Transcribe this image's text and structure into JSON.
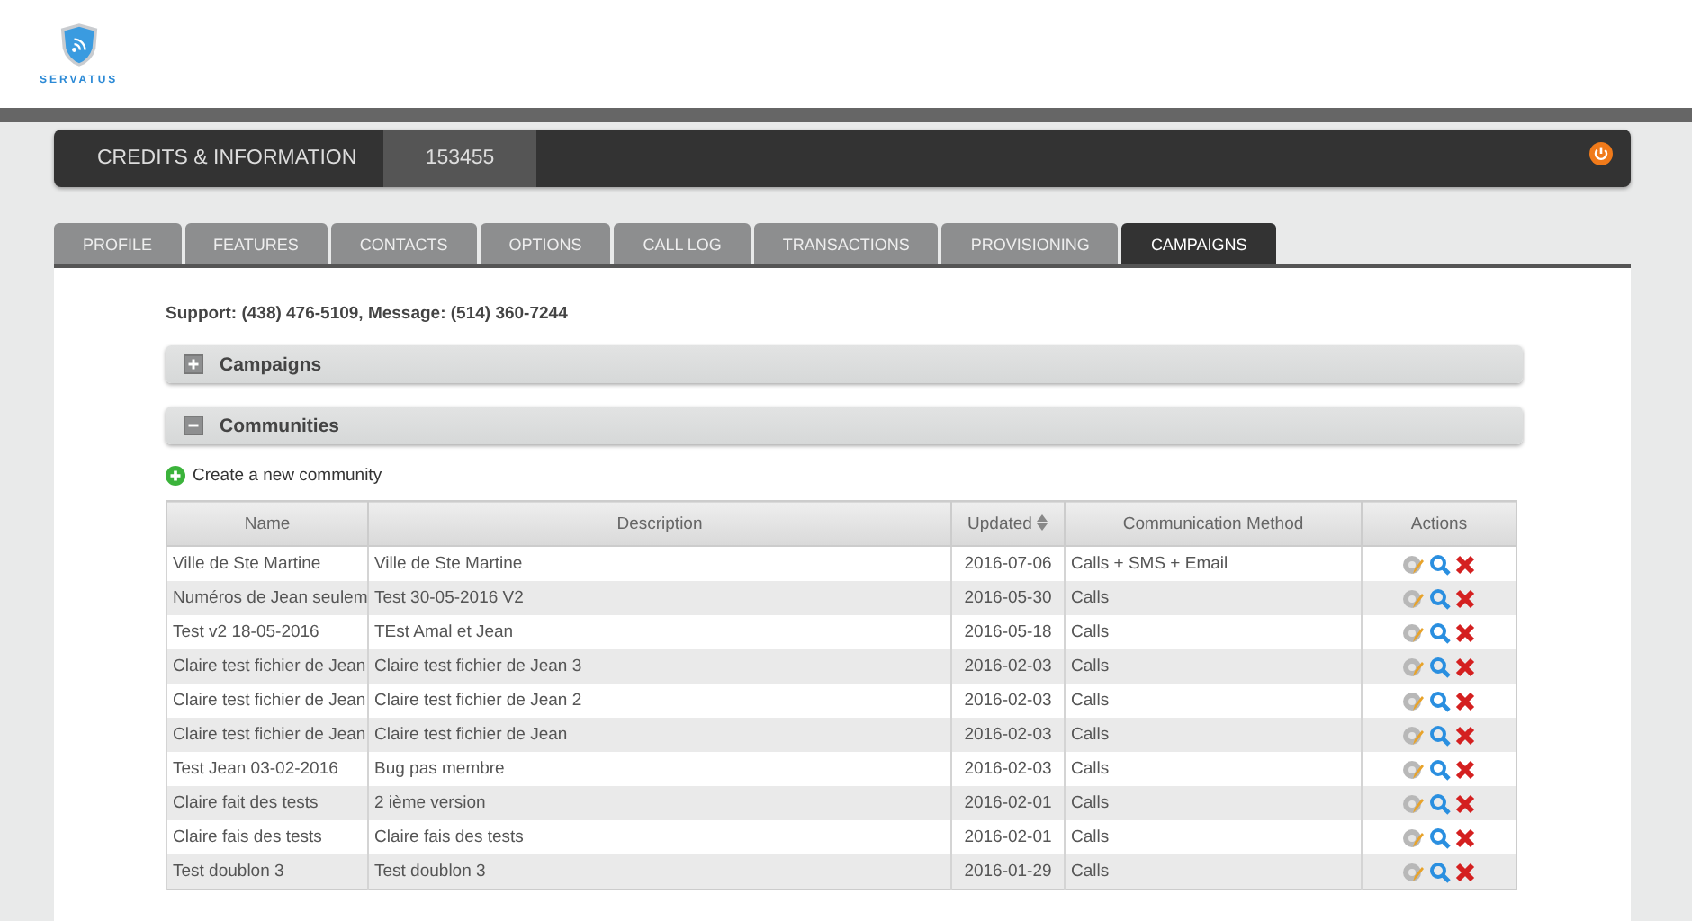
{
  "logo": {
    "text": "SERVATUS"
  },
  "top_bar": {
    "title": "CREDITS & INFORMATION",
    "account": "153455"
  },
  "tabs": [
    {
      "label": "PROFILE",
      "selected": false
    },
    {
      "label": "FEATURES",
      "selected": false
    },
    {
      "label": "CONTACTS",
      "selected": false
    },
    {
      "label": "OPTIONS",
      "selected": false
    },
    {
      "label": "CALL LOG",
      "selected": false
    },
    {
      "label": "TRANSACTIONS",
      "selected": false
    },
    {
      "label": "PROVISIONING",
      "selected": false
    },
    {
      "label": "CAMPAIGNS",
      "selected": true
    }
  ],
  "support_line": "Support: (438) 476-5109, Message: (514) 360-7244",
  "sections": [
    {
      "title": "Campaigns",
      "expanded": false
    },
    {
      "title": "Communities",
      "expanded": true
    }
  ],
  "create_link": "Create a new community",
  "table": {
    "columns": [
      {
        "label": "Name",
        "sortable": false
      },
      {
        "label": "Description",
        "sortable": false
      },
      {
        "label": "Updated",
        "sortable": true
      },
      {
        "label": "Communication Method",
        "sortable": false
      },
      {
        "label": "Actions",
        "sortable": false
      }
    ],
    "rows": [
      [
        "Ville de Ste Martine",
        "Ville de Ste Martine",
        "2016-07-06",
        "Calls + SMS + Email"
      ],
      [
        "Numéros de Jean seulem",
        "Test 30-05-2016 V2",
        "2016-05-30",
        "Calls"
      ],
      [
        "Test v2 18-05-2016",
        "TEst Amal et Jean",
        "2016-05-18",
        "Calls"
      ],
      [
        "Claire test fichier de Jean",
        "Claire test fichier de Jean 3",
        "2016-02-03",
        "Calls"
      ],
      [
        "Claire test fichier de Jean",
        "Claire test fichier de Jean 2",
        "2016-02-03",
        "Calls"
      ],
      [
        "Claire test fichier de Jean",
        "Claire test fichier de Jean",
        "2016-02-03",
        "Calls"
      ],
      [
        "Test Jean 03-02-2016",
        "Bug pas membre",
        "2016-02-03",
        "Calls"
      ],
      [
        "Claire fait des tests",
        "2 ième version",
        "2016-02-01",
        "Calls"
      ],
      [
        "Claire fais des tests",
        "Claire fais des tests",
        "2016-02-01",
        "Calls"
      ],
      [
        "Test doublon 3",
        "Test doublon 3",
        "2016-01-29",
        "Calls"
      ]
    ]
  }
}
